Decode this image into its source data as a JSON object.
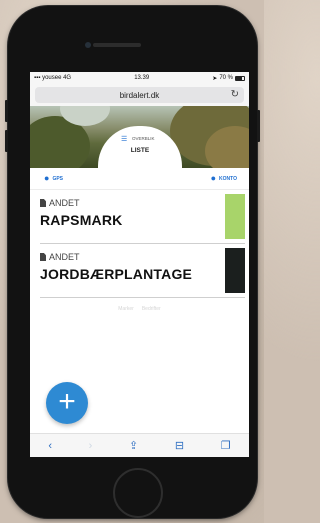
{
  "status": {
    "carrier": "yousee",
    "network": "4G",
    "time": "13.39",
    "battery": "70 %"
  },
  "browser": {
    "url": "birdalert.dk"
  },
  "hero": {
    "back_text": "",
    "site_text": ""
  },
  "view_toggle": {
    "alt_label": "OVERBLIK",
    "active_label": "LISTE"
  },
  "nav": {
    "gps_label": "GPS",
    "account_label": "KONTO"
  },
  "items": [
    {
      "category": "ANDET",
      "name": "RAPSMARK",
      "color": "#a8d46a"
    },
    {
      "category": "ANDET",
      "name": "JORDBÆRPLANTAGE",
      "color": "#1b1f1e"
    }
  ],
  "empty_tabs": {
    "left": "Marker",
    "right": "Bedrifter"
  },
  "fab": {
    "label": "+"
  },
  "toolbar": {
    "back": "‹",
    "forward": "›",
    "share": "⇪",
    "bookmarks": "⊟",
    "tabs": "❐"
  }
}
